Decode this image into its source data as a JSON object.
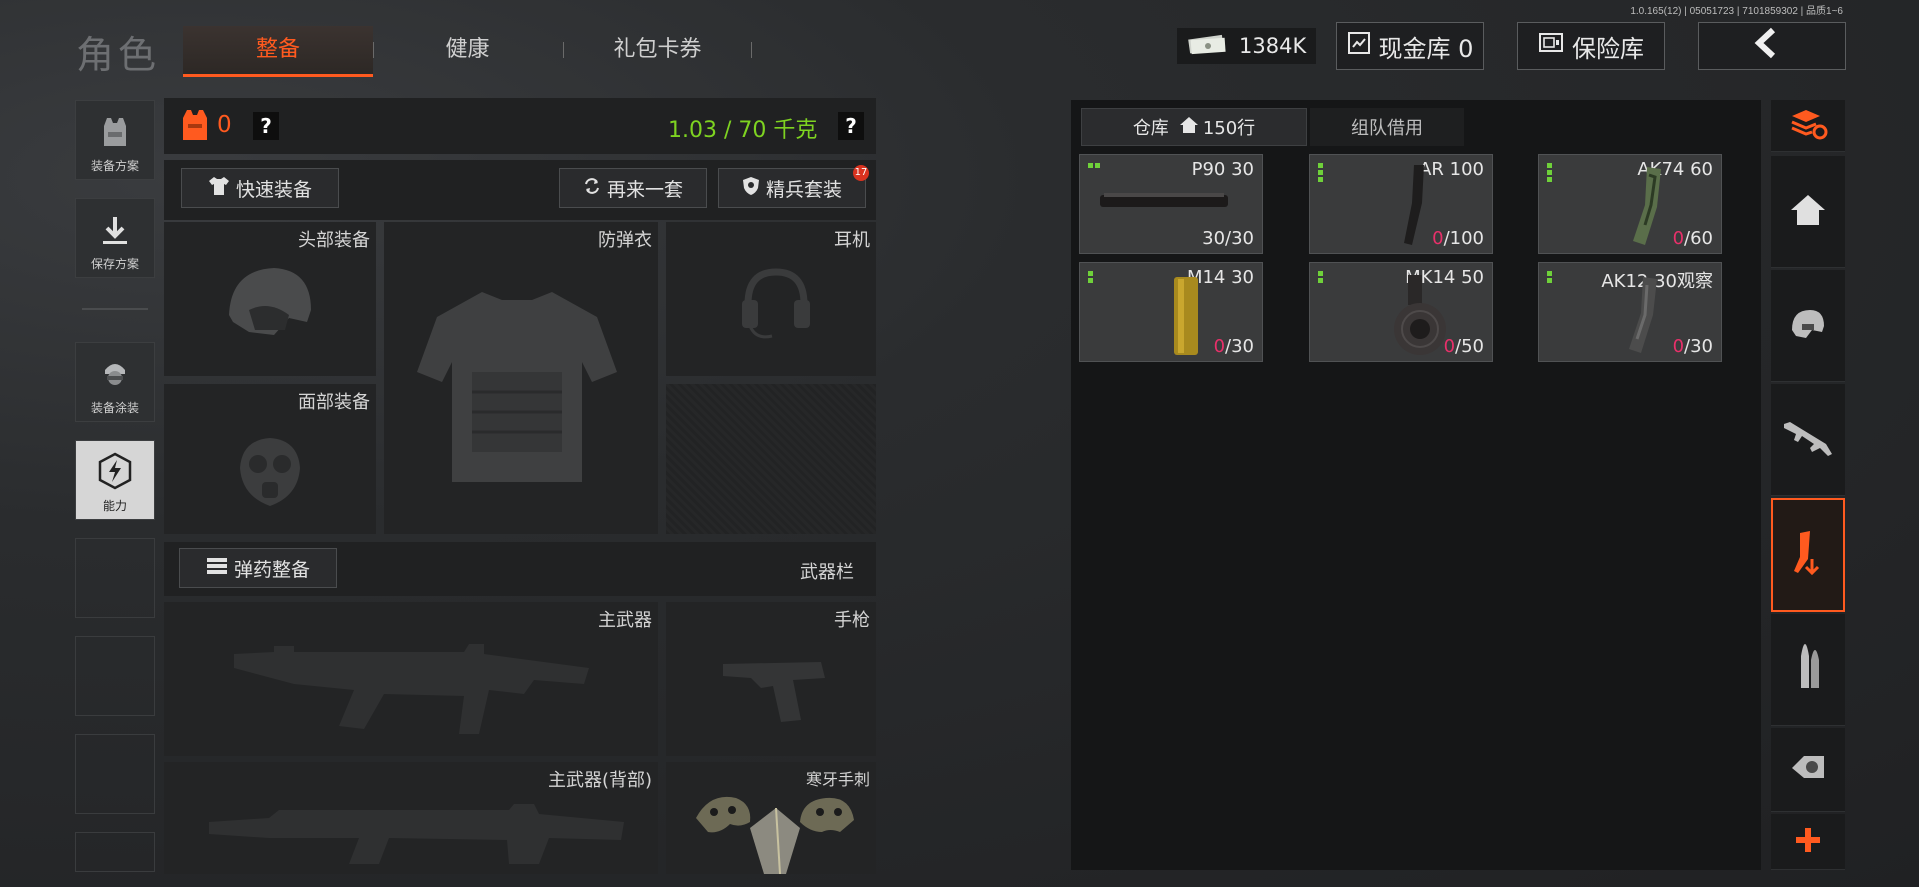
{
  "version": "1.0.165(12) | 05051723 | 7101859302 | 品质1~6",
  "header": {
    "title": "角色",
    "tabs": [
      {
        "label": "整备",
        "active": true
      },
      {
        "label": "健康",
        "active": false
      },
      {
        "label": "礼包卡券",
        "active": false
      }
    ],
    "money": "1384K",
    "cash_vault_label": "现金库 0",
    "safe_label": "保险库",
    "back_icon": "back-arrow-icon"
  },
  "left_nav": [
    {
      "label": "装备方案",
      "icon": "vest-icon"
    },
    {
      "label": "保存方案",
      "icon": "download-icon"
    },
    {
      "label": "装备涂装",
      "icon": "soldier-icon"
    },
    {
      "label": "能力",
      "icon": "ability-icon",
      "active": true
    }
  ],
  "loadout": {
    "armor_value": "0",
    "help_glyph": "?",
    "weight": "1.03 / 70 千克",
    "quick_equip": "快速装备",
    "again": "再来一套",
    "elite_set": "精兵套装",
    "elite_badge": "17",
    "slots": {
      "head": "头部装备",
      "vest": "防弹衣",
      "earphone": "耳机",
      "face": "面部装备"
    },
    "ammo_equip": "弹药整备",
    "weapon_bar": "武器栏",
    "weapons": {
      "primary": "主武器",
      "pistol": "手枪",
      "primary_back": "主武器(背部)",
      "knife": "寒牙手刺"
    }
  },
  "warehouse": {
    "tab_storage": "仓库",
    "tab_storage_count": "150行",
    "tab_team": "组队借用",
    "items": [
      {
        "name": "P90 30",
        "cur": "30",
        "max": "/30",
        "full": true,
        "quality": 2
      },
      {
        "name": "AR 100",
        "cur": "0",
        "max": "/100",
        "full": false,
        "quality": 3
      },
      {
        "name": "AK74 60",
        "cur": "0",
        "max": "/60",
        "full": false,
        "quality": 3
      },
      {
        "name": "M14 30",
        "cur": "0",
        "max": "/30",
        "full": false,
        "quality": 2
      },
      {
        "name": "MK14 50",
        "cur": "0",
        "max": "/50",
        "full": false,
        "quality": 2
      },
      {
        "name": "AK12 30观察",
        "cur": "0",
        "max": "/30",
        "full": false,
        "quality": 2
      }
    ]
  },
  "right_nav": [
    "stack-refresh-icon",
    "home-icon",
    "helmet-icon",
    "rifle-icon",
    "magazine-icon",
    "bullet-icon",
    "scope-icon",
    "plus-icon"
  ],
  "colors": {
    "accent": "#ff5a1f",
    "weight_green": "#7ed321",
    "quality_green": "#6fd13a",
    "empty_red": "#e8306a"
  }
}
